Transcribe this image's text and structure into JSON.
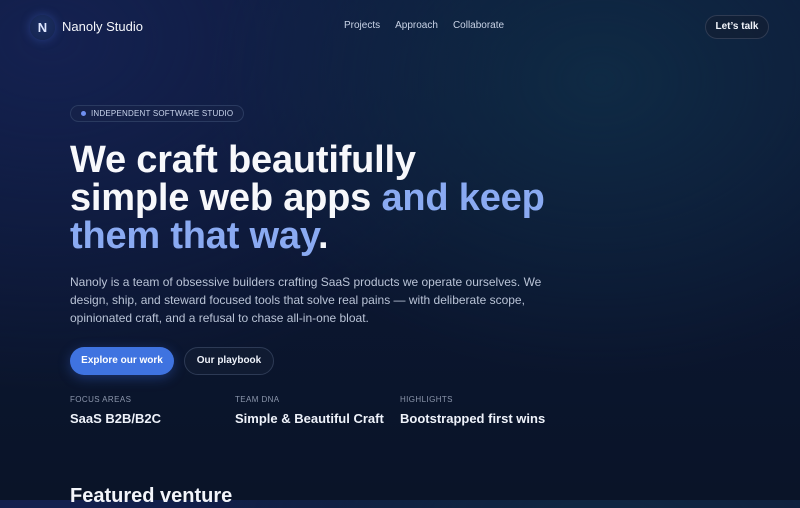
{
  "nav": {
    "logo_letter": "N",
    "brand": "Nanoly Studio",
    "links": [
      {
        "label": "Projects"
      },
      {
        "label": "Approach"
      },
      {
        "label": "Collaborate"
      }
    ],
    "cta": "Let’s talk"
  },
  "hero": {
    "badge": "INDEPENDENT SOFTWARE STUDIO",
    "headline": {
      "line1": "We craft beautifully",
      "line2_plain": "simple web apps ",
      "line2_accent": "and keep",
      "line3_accent": "them that way",
      "line3_end": "."
    },
    "description": "Nanoly is a team of obsessive builders crafting SaaS products we operate ourselves. We design, ship, and steward focused tools that solve real pains — with deliberate scope, opinionated craft, and a refusal to chase all-in-one bloat.",
    "primary_cta": "Explore our work",
    "secondary_cta": "Our playbook"
  },
  "stats": [
    {
      "label": "FOCUS AREAS",
      "value": "SaaS B2B/B2C"
    },
    {
      "label": "TEAM DNA",
      "value": "Simple & Beautiful Craft"
    },
    {
      "label": "HIGHLIGHTS",
      "value": "Bootstrapped first wins"
    }
  ],
  "featured": {
    "title": "Featured venture"
  },
  "colors": {
    "accent_text": "#8aaaf2",
    "primary_button": "#3f73e0",
    "background": "#0b1630"
  }
}
